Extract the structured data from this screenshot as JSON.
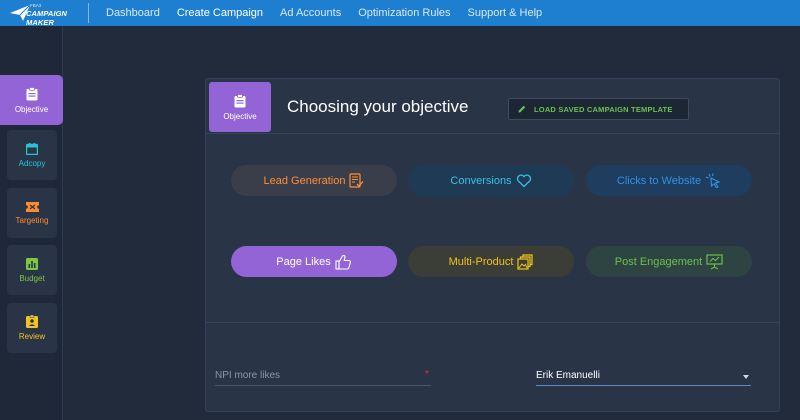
{
  "app": {
    "logo_small": "FBA3",
    "logo_text": "CAMPAIGN MAKER"
  },
  "nav": {
    "items": [
      {
        "label": "Dashboard"
      },
      {
        "label": "Create Campaign"
      },
      {
        "label": "Ad Accounts"
      },
      {
        "label": "Optimization Rules"
      },
      {
        "label": "Support & Help"
      }
    ]
  },
  "sidebar": {
    "items": [
      {
        "label": "Objective",
        "icon": "clipboard-icon",
        "color": "#ffffff"
      },
      {
        "label": "Adcopy",
        "icon": "calendar-icon",
        "color": "#24c6d6"
      },
      {
        "label": "Targeting",
        "icon": "ticket-icon",
        "color": "#ff8a2b"
      },
      {
        "label": "Budget",
        "icon": "bar-chart-icon",
        "color": "#7ac943"
      },
      {
        "label": "Review",
        "icon": "id-card-icon",
        "color": "#f6c325"
      }
    ]
  },
  "panel": {
    "badge_label": "Objective",
    "title": "Choosing your objective",
    "load_template_label": "LOAD SAVED CAMPAIGN TEMPLATE"
  },
  "objectives": {
    "lead_generation": "Lead Generation",
    "conversions": "Conversions",
    "clicks_to_website": "Clicks to Website",
    "page_likes": "Page Likes",
    "multi_product": "Multi-Product",
    "post_engagement": "Post Engagement",
    "selected": "Page Likes"
  },
  "form": {
    "name_placeholder": "NPI more likes",
    "required_marker": "*",
    "owner_value": "Erik Emanuelli"
  },
  "colors": {
    "topbar": "#1e7fd0",
    "accent_purple": "#9264d6",
    "background": "#212b3b",
    "panel": "#293447",
    "load_button_text": "#67c24e"
  }
}
